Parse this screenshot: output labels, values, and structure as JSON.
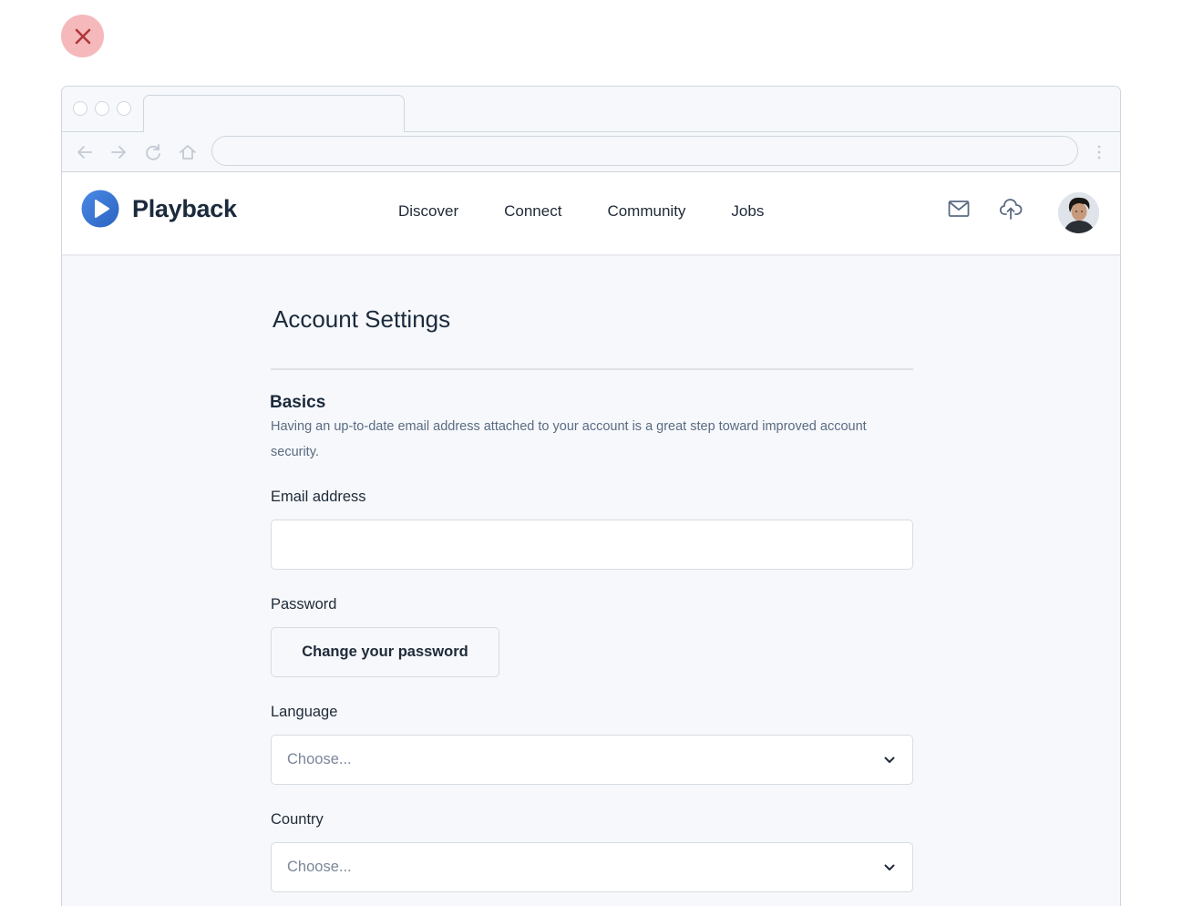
{
  "colors": {
    "accent": "#3b7bd8",
    "close_bg": "#f5b9bb",
    "close_icon": "#b0353b",
    "border": "#cfd6df",
    "text_dark": "#1b2a3c",
    "text_muted": "#5b6b82"
  },
  "icons": {
    "close": "close-icon",
    "back": "arrow-left-icon",
    "forward": "arrow-right-icon",
    "reload": "reload-icon",
    "home": "home-icon",
    "menu": "kebab-menu-icon",
    "logo": "play-icon",
    "mail": "mail-icon",
    "upload": "cloud-upload-icon",
    "chevron": "chevron-down-icon"
  },
  "app": {
    "brand": "Playback",
    "nav": [
      "Discover",
      "Connect",
      "Community",
      "Jobs"
    ]
  },
  "page": {
    "title": "Account Settings",
    "section": {
      "title": "Basics",
      "description": "Having an up-to-date email address attached to your account is a great step toward improved account security."
    },
    "email": {
      "label": "Email address",
      "value": "",
      "placeholder": ""
    },
    "password": {
      "label": "Password",
      "button": "Change your password"
    },
    "language": {
      "label": "Language",
      "value": "Choose..."
    },
    "country": {
      "label": "Country",
      "value": "Choose..."
    }
  }
}
